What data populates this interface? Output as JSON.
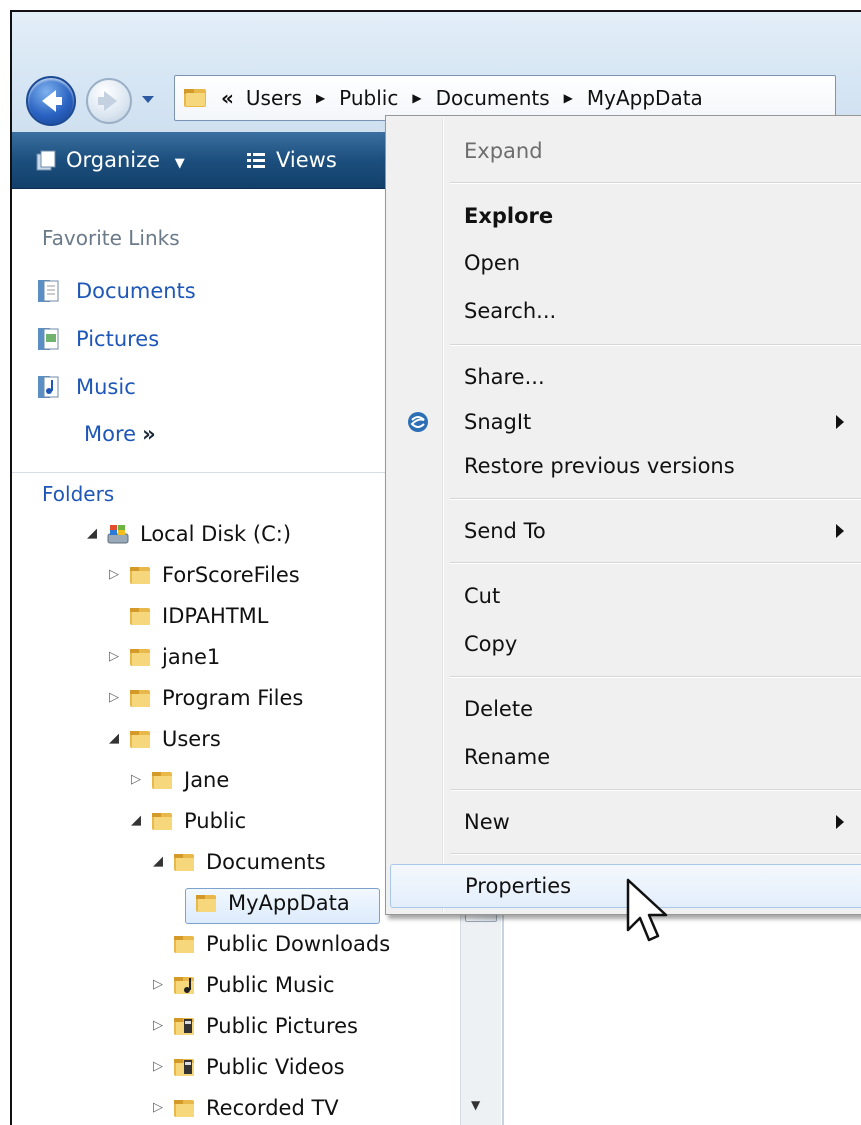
{
  "address_bar": {
    "overflow": "«",
    "crumbs": [
      "Users",
      "Public",
      "Documents",
      "MyAppData"
    ]
  },
  "toolbar": {
    "organize_label": "Organize",
    "views_label": "Views"
  },
  "favorites": {
    "title": "Favorite Links",
    "items": [
      {
        "label": "Documents",
        "icon": "documents-icon"
      },
      {
        "label": "Pictures",
        "icon": "pictures-icon"
      },
      {
        "label": "Music",
        "icon": "music-icon"
      }
    ],
    "more_label": "More",
    "more_chevron": "»"
  },
  "folders": {
    "title": "Folders",
    "tree": [
      {
        "label": "Local Disk (C:)",
        "icon": "drive-icon",
        "toggle": "expanded"
      },
      {
        "label": "ForScoreFiles",
        "icon": "folder-icon",
        "toggle": "collapsed"
      },
      {
        "label": "IDPAHTML",
        "icon": "folder-icon",
        "toggle": "none"
      },
      {
        "label": "jane1",
        "icon": "folder-icon",
        "toggle": "collapsed"
      },
      {
        "label": "Program Files",
        "icon": "folder-icon",
        "toggle": "collapsed"
      },
      {
        "label": "Users",
        "icon": "folder-icon",
        "toggle": "expanded"
      },
      {
        "label": "Jane",
        "icon": "folder-icon",
        "toggle": "collapsed"
      },
      {
        "label": "Public",
        "icon": "folder-icon",
        "toggle": "expanded"
      },
      {
        "label": "Documents",
        "icon": "folder-icon",
        "toggle": "expanded"
      },
      {
        "label": "MyAppData",
        "icon": "folder-icon",
        "toggle": "none",
        "selected": true
      },
      {
        "label": "Public Downloads",
        "icon": "folder-icon",
        "toggle": "none"
      },
      {
        "label": "Public Music",
        "icon": "music-folder-icon",
        "toggle": "collapsed"
      },
      {
        "label": "Public Pictures",
        "icon": "pictures-folder-icon",
        "toggle": "collapsed"
      },
      {
        "label": "Public Videos",
        "icon": "videos-folder-icon",
        "toggle": "collapsed"
      },
      {
        "label": "Recorded TV",
        "icon": "folder-icon",
        "toggle": "collapsed"
      }
    ]
  },
  "context_menu": {
    "items": [
      {
        "label": "Expand",
        "disabled": true
      },
      {
        "label": "Explore",
        "bold": true
      },
      {
        "label": "Open"
      },
      {
        "label": "Search..."
      },
      {
        "label": "Share..."
      },
      {
        "label": "SnagIt",
        "submenu": true,
        "icon": "snagit-icon"
      },
      {
        "label": "Restore previous versions"
      },
      {
        "label": "Send To",
        "submenu": true
      },
      {
        "label": "Cut"
      },
      {
        "label": "Copy"
      },
      {
        "label": "Delete"
      },
      {
        "label": "Rename"
      },
      {
        "label": "New",
        "submenu": true
      },
      {
        "label": "Properties",
        "highlighted": true
      }
    ]
  },
  "colors": {
    "link_blue": "#1e57b8",
    "toolbar_blue": "#1c4f7e",
    "menu_bg": "#f0f0f0",
    "highlight_border": "#a8c8ec"
  }
}
